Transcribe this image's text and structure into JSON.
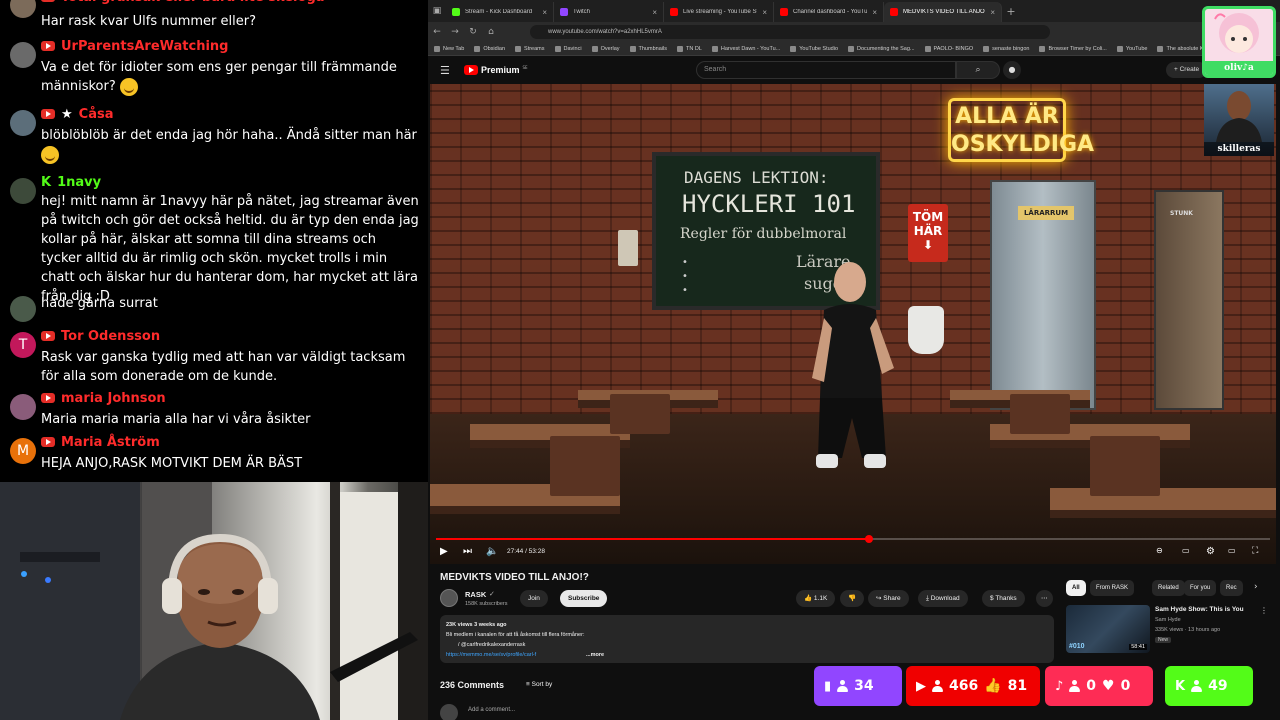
{
  "chat": {
    "messages": [
      {
        "platform": "youtube",
        "username": "Total gränsak eller bara lite skeloga",
        "avatar_letter": "",
        "avatar_color": "#7c6b5a",
        "text": "Har rask kvar Ulfs nummer eller?"
      },
      {
        "platform": "youtube",
        "username": "UrParentsAreWatching",
        "avatar_letter": "",
        "avatar_color": "#6a6a6a",
        "text": "Va e det för idioter som ens ger pengar till främmande människor?",
        "emoji": "grinning-squint"
      },
      {
        "platform": "youtube",
        "username": "Cåsa",
        "avatar_letter": "",
        "avatar_color": "#5c6e7a",
        "moderator_star": true,
        "text": "blöblöblöb är det enda jag hör haha.. Ändå sitter man här",
        "emoji": "smiling"
      },
      {
        "platform": "kick",
        "username": "1navy",
        "avatar_letter": "",
        "avatar_color": "#3d4a3a",
        "text": "hej! mitt namn är 1navyy här på nätet, jag streamar även på twitch och gör det också heltid. du är typ den enda jag kollar på här, älskar att somna till dina streams och tycker alltid du är rimlig och skön. mycket trolls i min chatt och älskar hur du hanterar dom, har mycket att lära från dig :D"
      },
      {
        "platform": "none",
        "username": "",
        "avatar_letter": "",
        "avatar_color": "#4a5a4a",
        "text": "hade gärna surrat"
      },
      {
        "platform": "youtube",
        "username": "Tor Odensson",
        "avatar_letter": "T",
        "avatar_color": "#c2185b",
        "text": "Rask var ganska tydlig med att han var väldigt tacksam för alla som donerade om de kunde."
      },
      {
        "platform": "youtube",
        "username": "maria Johnson",
        "avatar_letter": "",
        "avatar_color": "#8a5c7a",
        "text": "Maria maria maria alla har vi våra åsikter"
      },
      {
        "platform": "youtube",
        "username": "Maria Åström",
        "avatar_letter": "M",
        "avatar_color": "#e8710a",
        "text": "HEJA ANJO,RASK MOTVIKT DEM ÄR BÄST"
      }
    ]
  },
  "browser": {
    "tabs": [
      {
        "label": "Stream - Kick Dashboard",
        "color": "#53fc18"
      },
      {
        "label": "Twitch",
        "color": "#9146ff"
      },
      {
        "label": "Live streaming - YouTube Studio",
        "color": "#ff0000"
      },
      {
        "label": "Channel dashboard - YouTube Studio",
        "color": "#ff0000"
      },
      {
        "label": "MEDVIKTS VIDEO TILL ANJO!?",
        "color": "#ff0000",
        "active": true
      }
    ],
    "url": "www.youtube.com/watch?v=a2xhHL5vmrA",
    "bookmarks": [
      "New Tab",
      "Obsidian",
      "Streams",
      "Davinci",
      "Overlay",
      "Thumbnails",
      "TN DL",
      "Harvest Dawn - YouTu...",
      "YouTube Studio",
      "Documenting the Sag...",
      "PAOLO- BINGO",
      "senaste bingon",
      "Browser Timer by Coli...",
      "YouTube",
      "The absolute Kille..."
    ]
  },
  "youtube": {
    "logo_text": "Premium",
    "logo_sup": "SE",
    "search_placeholder": "Search",
    "create_label": "+ Create",
    "video": {
      "title": "MEDVIKTS VIDEO TILL ANJO!?",
      "time": "27:44 / 53:28",
      "progress": 0.519,
      "buffered": 0.58,
      "scene": {
        "board_line1": "DAGENS LEKTION:",
        "board_line2": "HYCKLERI 101",
        "board_line3": "Regler för dubbelmoral",
        "board_line4": "Lärare",
        "board_line5": "suge",
        "neon_line1": "ALLA ÄR",
        "neon_line2": "OSKYLDIGA",
        "sign_line1": "TÖM",
        "sign_line2": "HÄR",
        "door_sign": "LÄRARRUM",
        "door2_sign": "STUNK"
      }
    },
    "channel": {
      "name": "RASK",
      "subscribers": "158K subscribers",
      "join_label": "Join",
      "subscribe_label": "Subscribe"
    },
    "actions": {
      "likes": "1.1K",
      "share": "Share",
      "download": "Download",
      "thanks": "Thanks"
    },
    "description": {
      "meta": "23K views  3 weeks ago",
      "line1": "Bli medlem i kanalen för att få åskomst till flera förmåner:",
      "line2": "/ @carlfredrikalexanderrask",
      "line3": "https://memmo.me/se/sv/profile/carl-f",
      "more": "...more"
    },
    "comments": {
      "count": "236 Comments",
      "sort": "Sort by",
      "placeholder": "Add a comment..."
    },
    "chips": [
      "All",
      "From RASK",
      "Related",
      "For you",
      "Rec"
    ],
    "rec": {
      "title": "Sam Hyde Show: This is You",
      "channel": "Sam Hyde",
      "views": "335K views · 13 hours ago",
      "badge": "New",
      "duration": "58:41",
      "tag": "#010"
    }
  },
  "overlays": {
    "cam1_name": "oliv♪a",
    "cam2_name": "skilleras"
  },
  "viewers": [
    {
      "platform": "twitch",
      "count": "34",
      "color": "#9146ff"
    },
    {
      "platform": "youtube",
      "count": "466",
      "likes": "81",
      "color": "#f00000"
    },
    {
      "platform": "tiktok",
      "count": "0",
      "hearts": "0",
      "color": "#fe2c55"
    },
    {
      "platform": "kick",
      "count": "49",
      "color": "#53fc18"
    }
  ]
}
